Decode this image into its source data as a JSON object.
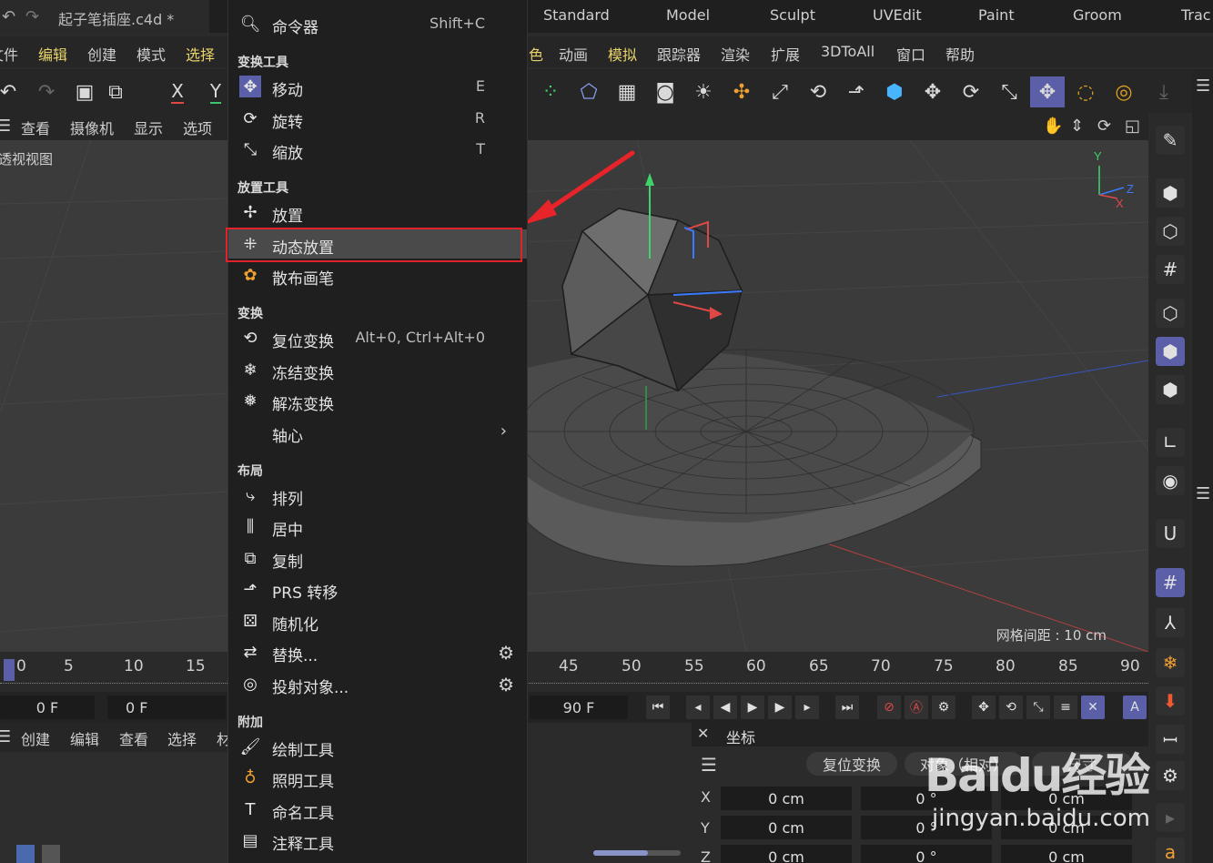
{
  "title_bar": {
    "filename": "起子笔插座.c4d *",
    "workspaces": [
      "Standard",
      "Model",
      "Sculpt",
      "UVEdit",
      "Paint",
      "Groom",
      "Trac"
    ]
  },
  "menu_bar": {
    "left_items": [
      "文件",
      "编辑",
      "创建",
      "模式",
      "选择"
    ],
    "right_items": [
      "角色",
      "动画",
      "模拟",
      "跟踪器",
      "渲染",
      "扩展",
      "3DToAll",
      "窗口",
      "帮助"
    ]
  },
  "toolbar": {
    "axis_x": "X",
    "axis_y": "Y"
  },
  "viewport": {
    "menu": [
      "查看",
      "摄像机",
      "显示",
      "选项"
    ],
    "view_name": "透视视图",
    "grid_spacing": "网格间距 : 10 cm",
    "axis_gizmo": {
      "y": "Y",
      "z": "Z",
      "x": "X"
    }
  },
  "timeline": {
    "ticks": [
      "0",
      "5",
      "10",
      "15",
      "45",
      "50",
      "55",
      "60",
      "65",
      "70",
      "75",
      "80",
      "85",
      "90"
    ],
    "current_frame": "0 F",
    "start_frame": "0 F",
    "end_frame": "90 F"
  },
  "bottom_left": {
    "menu": [
      "创建",
      "编辑",
      "查看",
      "选择",
      "材"
    ]
  },
  "coordinates": {
    "title": "坐标",
    "reset_button": "复位变换",
    "mode": "对象（相对）",
    "size_label": "尺寸",
    "rows": [
      {
        "axis": "X",
        "pos": "0 cm",
        "rot": "0 °",
        "size": "0 cm"
      },
      {
        "axis": "Y",
        "pos": "0 cm",
        "rot": "0 °",
        "size": "0 cm"
      },
      {
        "axis": "Z",
        "pos": "0 cm",
        "rot": "0 °",
        "size": "0 cm"
      }
    ]
  },
  "dropdown": {
    "command": {
      "label": "命令器",
      "shortcut": "Shift+C"
    },
    "sections": [
      {
        "title": "变换工具"
      },
      {
        "title": "放置工具"
      },
      {
        "title": "变换"
      },
      {
        "title": "布局"
      },
      {
        "title": "附加"
      }
    ],
    "items": {
      "move": {
        "label": "移动",
        "shortcut": "E"
      },
      "rotate": {
        "label": "旋转",
        "shortcut": "R"
      },
      "scale": {
        "label": "缩放",
        "shortcut": "T"
      },
      "place": {
        "label": "放置"
      },
      "dynamic_place": {
        "label": "动态放置"
      },
      "scatter_brush": {
        "label": "散布画笔"
      },
      "reset_transform": {
        "label": "复位变换",
        "shortcut": "Alt+0, Ctrl+Alt+0"
      },
      "freeze_transform": {
        "label": "冻结变换"
      },
      "unfreeze_transform": {
        "label": "解冻变换"
      },
      "pivot": {
        "label": "轴心"
      },
      "arrange": {
        "label": "排列"
      },
      "center": {
        "label": "居中"
      },
      "duplicate": {
        "label": "复制"
      },
      "prs_transfer": {
        "label": "PRS 转移"
      },
      "randomize": {
        "label": "随机化"
      },
      "replace": {
        "label": "替换..."
      },
      "project": {
        "label": "投射对象..."
      },
      "paint_tool": {
        "label": "绘制工具"
      },
      "lighting_tool": {
        "label": "照明工具"
      },
      "naming_tool": {
        "label": "命名工具"
      },
      "annotation_tool": {
        "label": "注释工具"
      }
    }
  },
  "watermark": {
    "logo": "Baidu经验",
    "url": "jingyan.baidu.com"
  },
  "colors": {
    "accent": "#5a5fa8",
    "highlight_border": "#e0232a",
    "menu_bg": "#1f1f1f",
    "viewport_bg": "#3b3b3b"
  }
}
